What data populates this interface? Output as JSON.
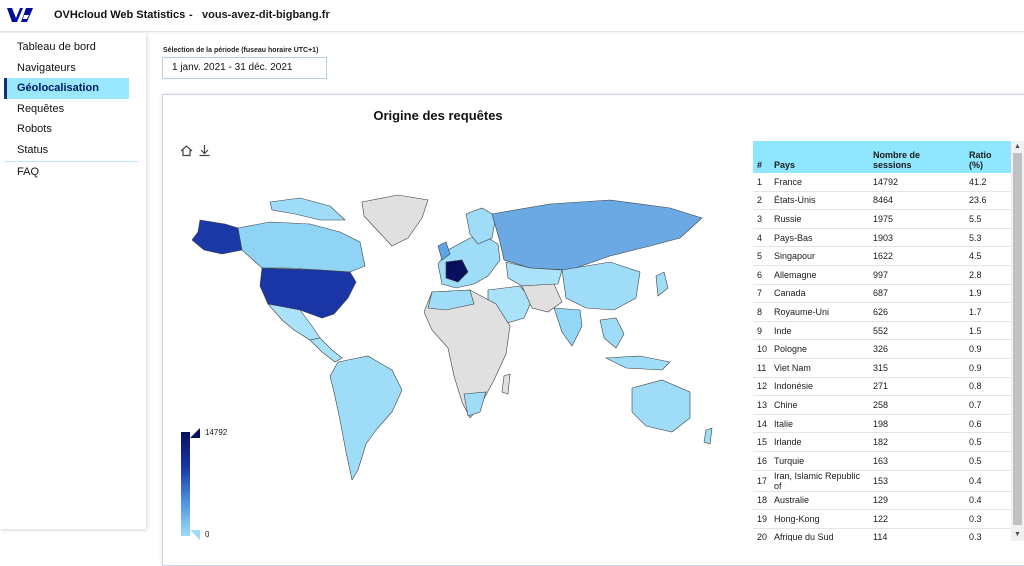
{
  "header": {
    "app_title": "OVHcloud Web Statistics",
    "separator": "-",
    "site": "vous-avez-dit-bigbang.fr",
    "logo_icon": "ovhcloud-logo-icon",
    "logo_color": "#000e9c"
  },
  "sidebar": {
    "items": [
      {
        "label": "Tableau de bord",
        "active": false
      },
      {
        "label": "Navigateurs",
        "active": false
      },
      {
        "label": "Géolocalisation",
        "active": true
      },
      {
        "label": "Requêtes",
        "active": false
      },
      {
        "label": "Robots",
        "active": false
      },
      {
        "label": "Status",
        "active": false
      }
    ],
    "faq": "FAQ"
  },
  "period": {
    "label": "Sélection de la période (fuseau horaire UTC+1)",
    "value": "1 janv. 2021 - 31 déc. 2021"
  },
  "chart": {
    "title": "Origine des requêtes",
    "tools": [
      "home-icon",
      "download-icon"
    ],
    "legend_max": "14792",
    "legend_min": "0",
    "colors": {
      "min": "#9edcf8",
      "max": "#08105e",
      "no_data": "#e0e0e0"
    }
  },
  "table": {
    "headers": [
      "#",
      "Pays",
      "Nombre de sessions",
      "Ratio (%)"
    ],
    "rows": [
      [
        "1",
        "France",
        "14792",
        "41.2"
      ],
      [
        "2",
        "États-Unis",
        "8464",
        "23.6"
      ],
      [
        "3",
        "Russie",
        "1975",
        "5.5"
      ],
      [
        "4",
        "Pays-Bas",
        "1903",
        "5.3"
      ],
      [
        "5",
        "Singapour",
        "1622",
        "4.5"
      ],
      [
        "6",
        "Allemagne",
        "997",
        "2.8"
      ],
      [
        "7",
        "Canada",
        "687",
        "1.9"
      ],
      [
        "8",
        "Royaume-Uni",
        "626",
        "1.7"
      ],
      [
        "9",
        "Inde",
        "552",
        "1.5"
      ],
      [
        "10",
        "Pologne",
        "326",
        "0.9"
      ],
      [
        "11",
        "Viet Nam",
        "315",
        "0.9"
      ],
      [
        "12",
        "Indonésie",
        "271",
        "0.8"
      ],
      [
        "13",
        "Chine",
        "258",
        "0.7"
      ],
      [
        "14",
        "Italie",
        "198",
        "0.6"
      ],
      [
        "15",
        "Irlande",
        "182",
        "0.5"
      ],
      [
        "16",
        "Turquie",
        "163",
        "0.5"
      ],
      [
        "17",
        "Iran, Islamic Republic of",
        "153",
        "0.4"
      ],
      [
        "18",
        "Australie",
        "129",
        "0.4"
      ],
      [
        "19",
        "Hong-Kong",
        "122",
        "0.3"
      ],
      [
        "20",
        "Afrique du Sud",
        "114",
        "0.3"
      ]
    ]
  }
}
